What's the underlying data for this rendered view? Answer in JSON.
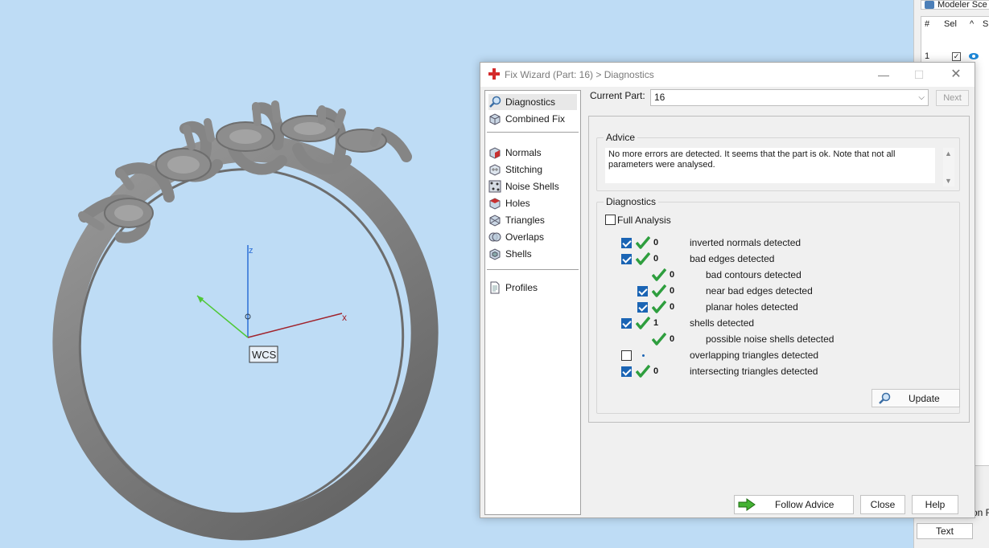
{
  "viewport": {
    "axis_z": "z",
    "axis_x": "x",
    "wcs_label": "WCS",
    "colors": {
      "background": "#bedcf5",
      "z_axis": "#2c6ed6",
      "x_axis": "#a0232c",
      "y_axis": "#4fc836",
      "ring": "#8a8a8a"
    }
  },
  "side_panel": {
    "title": "Modeler Sce",
    "headers": [
      "#",
      "Sel",
      "^",
      "Sl"
    ],
    "row_index": "1",
    "check_mark": "✓",
    "eye_icon": "eye-icon",
    "text_button": "Text",
    "partial_label": "on F"
  },
  "dialog": {
    "title": "Fix Wizard (Part: 16) > Diagnostics",
    "win_min": "—",
    "win_max": "☐",
    "win_close": "✕",
    "current_part_label": "Current Part:",
    "current_part_value": "16",
    "dropdown_arrow": "⌵",
    "next_label": "Next",
    "nav": [
      {
        "label": "Diagnostics",
        "icon": "magnifier-icon",
        "active": true
      },
      {
        "label": "Combined Fix",
        "icon": "cube-icon"
      },
      {
        "label": "Normals",
        "icon": "normals-icon"
      },
      {
        "label": "Stitching",
        "icon": "stitching-icon"
      },
      {
        "label": "Noise Shells",
        "icon": "noise-shells-icon"
      },
      {
        "label": "Holes",
        "icon": "holes-icon"
      },
      {
        "label": "Triangles",
        "icon": "triangles-icon"
      },
      {
        "label": "Overlaps",
        "icon": "overlaps-icon"
      },
      {
        "label": "Shells",
        "icon": "shells-icon"
      },
      {
        "label": "Profiles",
        "icon": "document-icon"
      }
    ],
    "advice": {
      "title": "Advice",
      "text": "No more errors are detected. It seems that the part is ok. Note that not all parameters were analysed.",
      "scroll_up": "▲",
      "scroll_down": "▼"
    },
    "diagnostics": {
      "title": "Diagnostics",
      "full_analysis_label": "Full Analysis",
      "full_analysis_checked": false,
      "rows": [
        {
          "label": "inverted normals detected",
          "count": "0",
          "checked": true,
          "ok": true
        },
        {
          "label": "bad edges detected",
          "count": "0",
          "checked": true,
          "ok": true
        },
        {
          "label": "bad contours detected",
          "count": "0",
          "checked": null,
          "ok": true
        },
        {
          "label": "near bad edges detected",
          "count": "0",
          "checked": true,
          "ok": true
        },
        {
          "label": "planar holes detected",
          "count": "0",
          "checked": true,
          "ok": true
        },
        {
          "label": "shells detected",
          "count": "1",
          "checked": true,
          "ok": true
        },
        {
          "label": "possible noise shells detected",
          "count": "0",
          "checked": null,
          "ok": true
        },
        {
          "label": "overlapping triangles detected",
          "count": "",
          "checked": false,
          "ok": false
        },
        {
          "label": "intersecting triangles detected",
          "count": "0",
          "checked": true,
          "ok": true
        }
      ]
    },
    "update_label": "Update",
    "follow_advice_label": "Follow Advice",
    "close_label": "Close",
    "help_label": "Help",
    "accent_color": "#1a64b4",
    "ok_color": "#2e9e3e"
  }
}
